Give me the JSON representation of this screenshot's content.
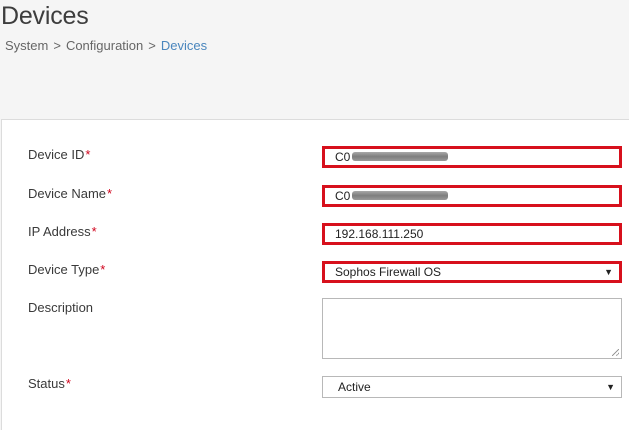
{
  "page": {
    "title": "Devices"
  },
  "breadcrumb": {
    "items": [
      "System",
      "Configuration",
      "Devices"
    ],
    "separator": ">"
  },
  "form": {
    "required_mark": "*",
    "device_id": {
      "label": "Device ID",
      "value_prefix": "C0",
      "redacted": true
    },
    "device_name": {
      "label": "Device Name",
      "value_prefix": "C0",
      "redacted": true
    },
    "ip_address": {
      "label": "IP Address",
      "value": "192.168.111.250"
    },
    "device_type": {
      "label": "Device Type",
      "selected": "Sophos Firewall OS"
    },
    "description": {
      "label": "Description",
      "value": ""
    },
    "status": {
      "label": "Status",
      "selected": "Active"
    }
  },
  "icons": {
    "dropdown": "chevron-down-icon",
    "resize": "resize-grip-icon"
  },
  "colors": {
    "highlight": "#d7101c",
    "required": "#d0021b",
    "link": "#4a86bd"
  }
}
